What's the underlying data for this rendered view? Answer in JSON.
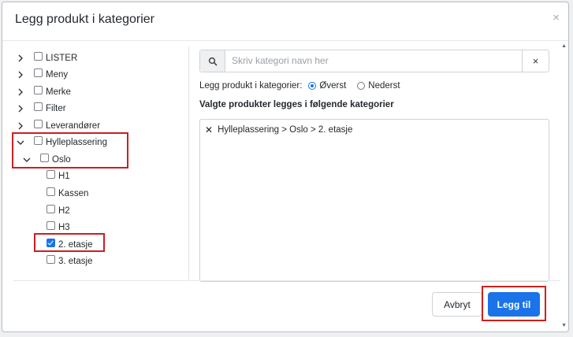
{
  "modal": {
    "title": "Legg produkt i kategorier",
    "close_glyph": "×"
  },
  "tree": {
    "nodes": [
      {
        "label": "LISTER",
        "expanded": false,
        "checked": false
      },
      {
        "label": "Meny",
        "expanded": false,
        "checked": false
      },
      {
        "label": "Merke",
        "expanded": false,
        "checked": false
      },
      {
        "label": "Filter",
        "expanded": false,
        "checked": false
      },
      {
        "label": "Leverandører",
        "expanded": false,
        "checked": false
      },
      {
        "label": "Hylleplassering",
        "expanded": true,
        "checked": false
      },
      {
        "label": "Oslo",
        "expanded": true,
        "checked": false
      },
      {
        "label": "H1",
        "checked": false
      },
      {
        "label": "Kassen",
        "checked": false
      },
      {
        "label": "H2",
        "checked": false
      },
      {
        "label": "H3",
        "checked": false
      },
      {
        "label": "2. etasje",
        "checked": true
      },
      {
        "label": "3. etasje",
        "checked": false
      }
    ]
  },
  "search": {
    "placeholder": "Skriv kategori navn her",
    "value": "",
    "clear_glyph": "×"
  },
  "placement": {
    "label": "Legg produkt i kategorier:",
    "options": [
      {
        "label": "Øverst",
        "selected": true
      },
      {
        "label": "Nederst",
        "selected": false
      }
    ]
  },
  "selected": {
    "heading": "Valgte produkter legges i følgende kategorier",
    "items": [
      {
        "remove_glyph": "✕",
        "path": "Hylleplassering > Oslo > 2. etasje"
      }
    ]
  },
  "footer": {
    "cancel_label": "Avbryt",
    "add_label": "Legg til"
  },
  "colors": {
    "primary": "#1a73e8",
    "highlight": "#cc1f1f"
  }
}
